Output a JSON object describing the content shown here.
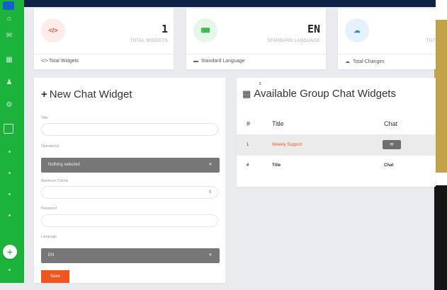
{
  "stats": [
    {
      "icon": "code-icon",
      "icon_text": "</>",
      "value": "1",
      "label": "TOTAL WIDGETS",
      "footer_icon": "code-icon",
      "footer": "Total Widgets",
      "accent": "#f0541f",
      "tint": "#fdecea"
    },
    {
      "icon": "keyboard-icon",
      "icon_text": "⌨",
      "value": "EN",
      "label": "STANDARD LANGUAGE",
      "footer_icon": "keyboard-icon",
      "footer": "Standard Language",
      "accent": "#2eb44a",
      "tint": "#e6f6e9"
    },
    {
      "icon": "cloud-icon",
      "icon_text": "☁",
      "value": "",
      "label": "TOT",
      "footer_icon": "cloud-icon",
      "footer": "Total Changes",
      "accent": "#2f88e0",
      "tint": "#e5f1fc"
    }
  ],
  "form": {
    "title": "New Chat Widget",
    "fields": {
      "title_label": "Title",
      "operators_label": "Operator(s)",
      "operators_value": "Nothing selected",
      "max_clients_label": "Maximum Clients",
      "max_clients_value": "",
      "password_label": "Password",
      "password_value": "",
      "language_label": "Language",
      "language_value": "EN"
    },
    "save_label": "Save",
    "accent": "#f0541f"
  },
  "widgets_table": {
    "title": "Available Group Chat Widgets",
    "tiny_mark": "5",
    "columns": [
      "#",
      "Title",
      "Chat"
    ],
    "rows": [
      {
        "num": "1",
        "title": "Weekly Support",
        "chat_icon": "chat-icon"
      }
    ]
  },
  "colors": {
    "sidebar": "#1cb33c",
    "topbar": "#0f2147",
    "accent_orange": "#f0541f"
  }
}
